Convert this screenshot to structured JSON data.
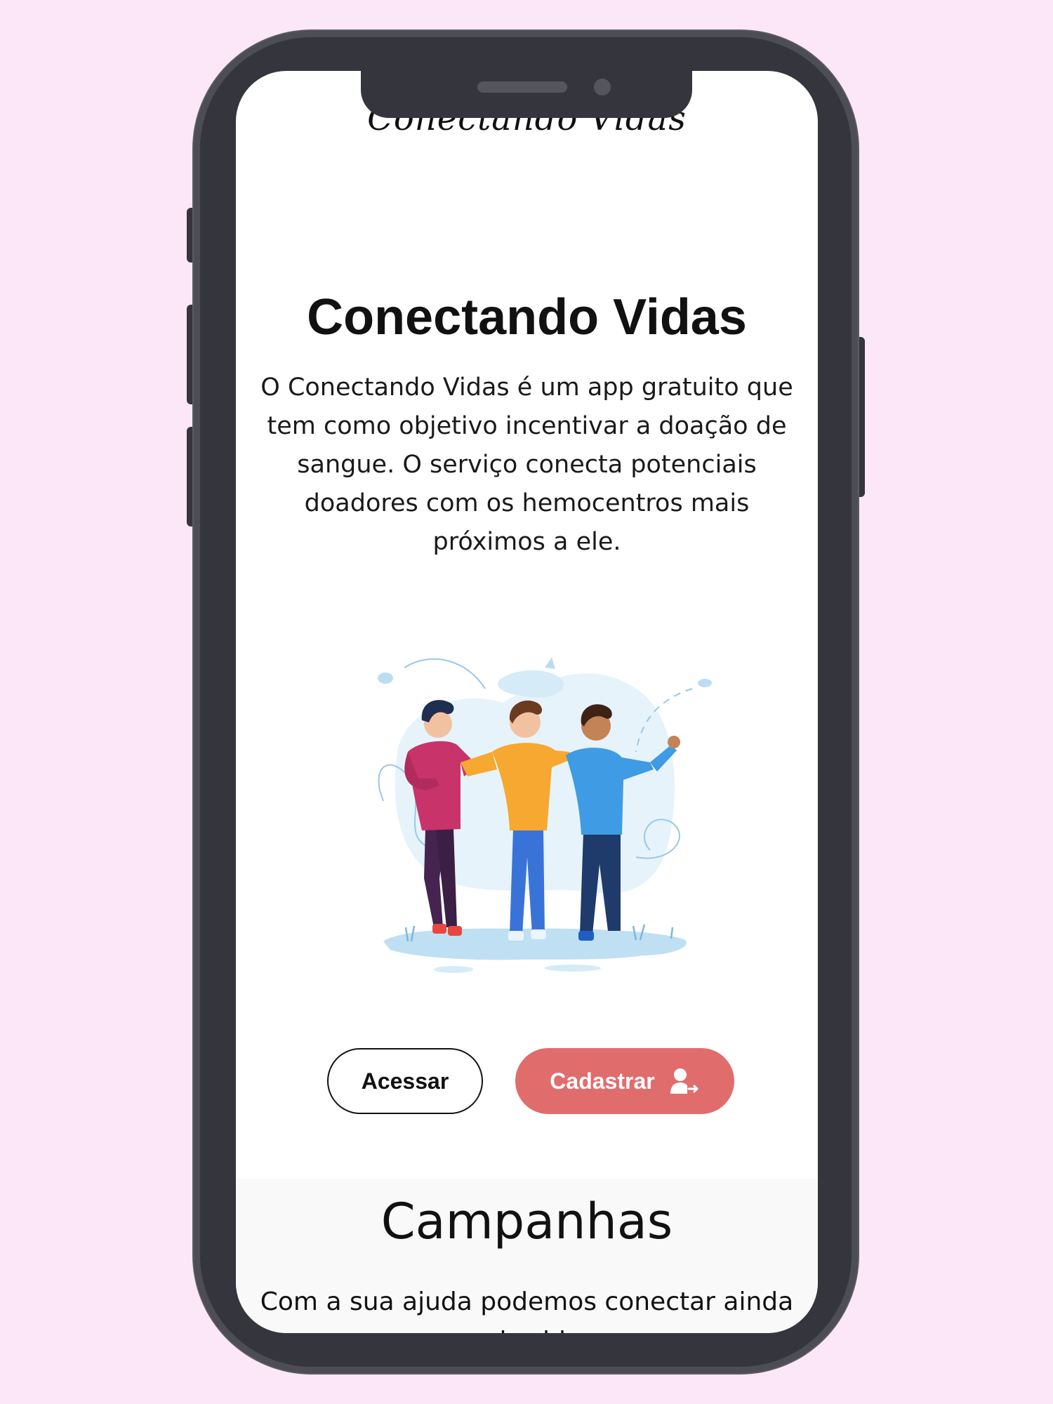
{
  "app": {
    "logo_text": "Conectando Vidas"
  },
  "hero": {
    "title": "Conectando Vidas",
    "description": "O Conectando Vidas é um app gratuito que tem como objetivo incentivar a doação de sangue. O serviço conecta potenciais doadores com os hemocentros mais próximos a ele."
  },
  "illustration": {
    "icon": "friends-walking-illustration"
  },
  "actions": {
    "access_label": "Acessar",
    "register_label": "Cadastrar",
    "register_icon": "user-add-icon"
  },
  "campaigns": {
    "title": "Campanhas",
    "description": "Com a sua ajuda podemos conectar ainda mais vidas"
  },
  "colors": {
    "background": "#fce7f8",
    "phone_frame": "#35353d",
    "accent": "#e16c6c"
  }
}
